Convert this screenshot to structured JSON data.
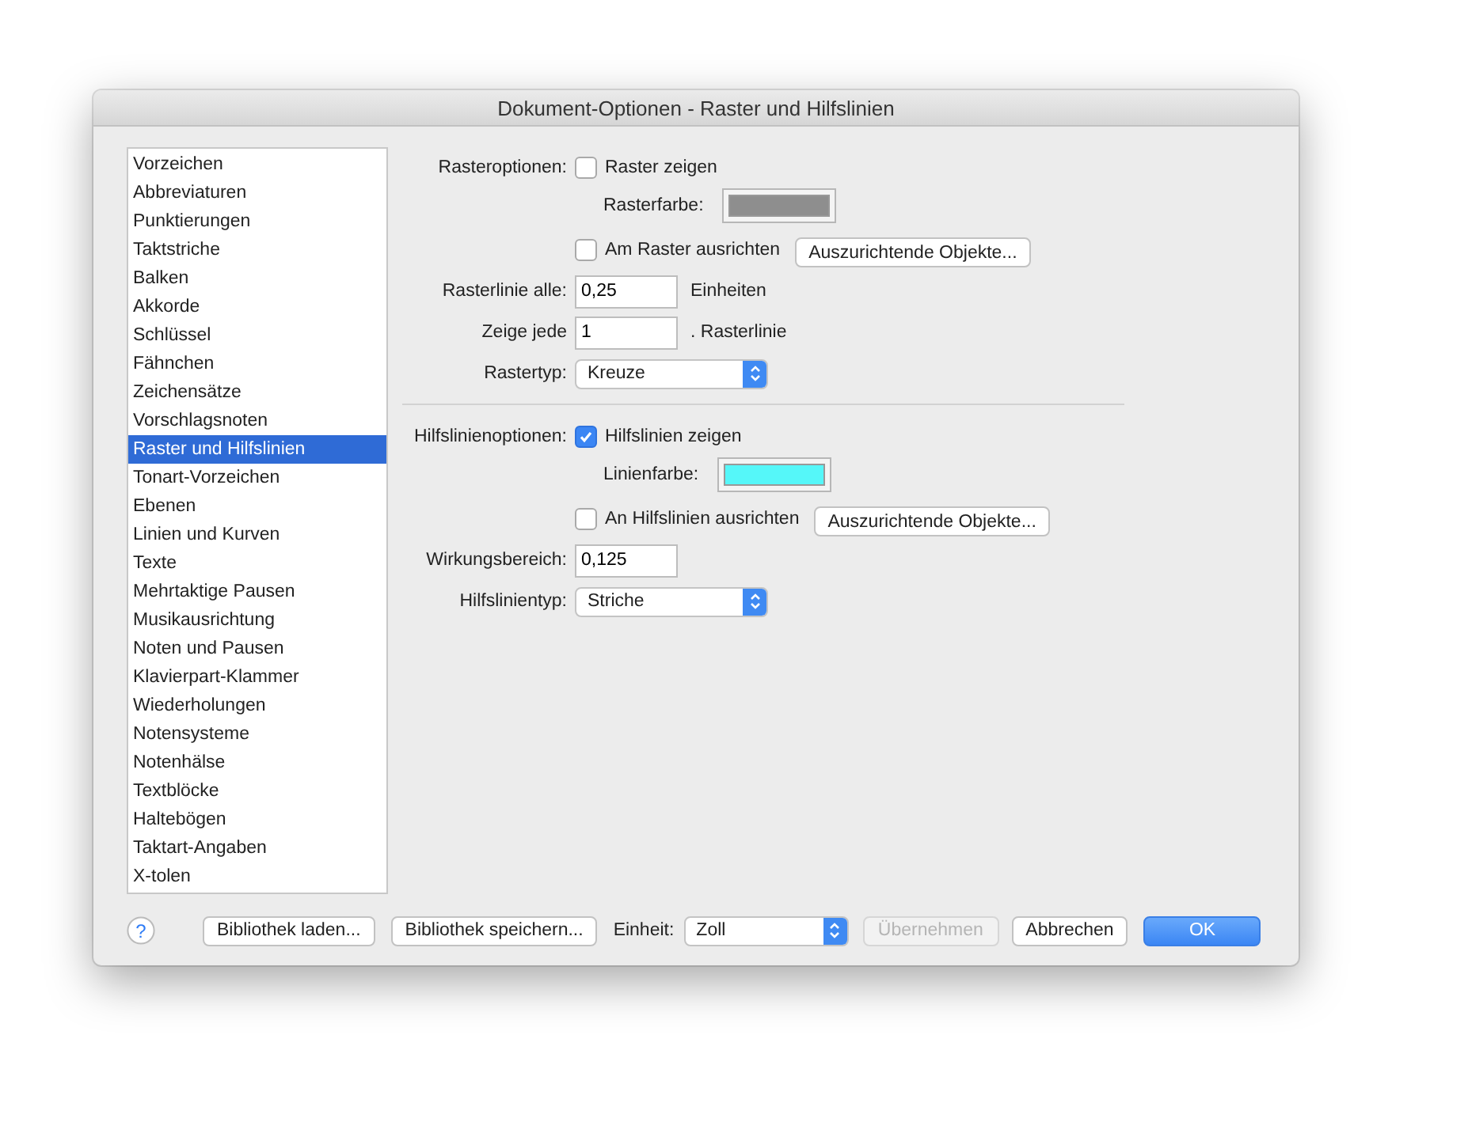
{
  "window": {
    "title": "Dokument-Optionen - Raster und Hilfslinien"
  },
  "sidebar": {
    "items": [
      {
        "label": "Vorzeichen",
        "selected": false
      },
      {
        "label": "Abbreviaturen",
        "selected": false
      },
      {
        "label": "Punktierungen",
        "selected": false
      },
      {
        "label": "Taktstriche",
        "selected": false
      },
      {
        "label": "Balken",
        "selected": false
      },
      {
        "label": "Akkorde",
        "selected": false
      },
      {
        "label": "Schlüssel",
        "selected": false
      },
      {
        "label": "Fähnchen",
        "selected": false
      },
      {
        "label": "Zeichensätze",
        "selected": false
      },
      {
        "label": "Vorschlagsnoten",
        "selected": false
      },
      {
        "label": "Raster und Hilfslinien",
        "selected": true
      },
      {
        "label": "Tonart-Vorzeichen",
        "selected": false
      },
      {
        "label": "Ebenen",
        "selected": false
      },
      {
        "label": "Linien und Kurven",
        "selected": false
      },
      {
        "label": "Texte",
        "selected": false
      },
      {
        "label": "Mehrtaktige Pausen",
        "selected": false
      },
      {
        "label": "Musikausrichtung",
        "selected": false
      },
      {
        "label": "Noten und Pausen",
        "selected": false
      },
      {
        "label": "Klavierpart-Klammer",
        "selected": false
      },
      {
        "label": "Wiederholungen",
        "selected": false
      },
      {
        "label": "Notensysteme",
        "selected": false
      },
      {
        "label": "Notenhälse",
        "selected": false
      },
      {
        "label": "Textblöcke",
        "selected": false
      },
      {
        "label": "Haltebögen",
        "selected": false
      },
      {
        "label": "Taktart-Angaben",
        "selected": false
      },
      {
        "label": "X-tolen",
        "selected": false
      }
    ]
  },
  "sections": [
    {
      "rows": [
        {
          "kind": "checkbox",
          "label": "Rasteroptionen:",
          "text": "Raster zeigen",
          "checked": false
        },
        {
          "kind": "color",
          "text": "Rasterfarbe:",
          "color": "#8e8e8e"
        },
        {
          "kind": "checkbox",
          "text": "Am Raster ausrichten",
          "checked": false,
          "button": "Auszurichtende Objekte..."
        },
        {
          "kind": "field",
          "label": "Rasterlinie alle:",
          "value": "0,25",
          "suffix": "Einheiten"
        },
        {
          "kind": "field",
          "label": "Zeige jede",
          "value": "1",
          "suffix": ". Rasterlinie"
        },
        {
          "kind": "select",
          "label": "Rastertyp:",
          "value": "Kreuze"
        }
      ]
    },
    {
      "rows": [
        {
          "kind": "checkbox",
          "label": "Hilfslinienoptionen:",
          "text": "Hilfslinien zeigen",
          "checked": true
        },
        {
          "kind": "color",
          "text": "Linienfarbe:",
          "color": "#55f7f9"
        },
        {
          "kind": "checkbox",
          "text": "An Hilfslinien ausrichten",
          "checked": false,
          "button": "Auszurichtende Objekte..."
        },
        {
          "kind": "field",
          "label": "Wirkungsbereich:",
          "value": "0,125"
        },
        {
          "kind": "select",
          "label": "Hilfslinientyp:",
          "value": "Striche"
        }
      ]
    }
  ],
  "footer": {
    "help": "?",
    "buttons": [
      {
        "label": "Bibliothek laden...",
        "disabled": false
      },
      {
        "label": "Bibliothek speichern...",
        "disabled": false
      }
    ],
    "unit_label": "Einheit:",
    "unit_value": "Zoll",
    "actions": [
      {
        "label": "Übernehmen",
        "disabled": true,
        "default": false
      },
      {
        "label": "Abbrechen",
        "disabled": false,
        "default": false
      },
      {
        "label": "OK",
        "disabled": false,
        "default": true
      }
    ]
  }
}
